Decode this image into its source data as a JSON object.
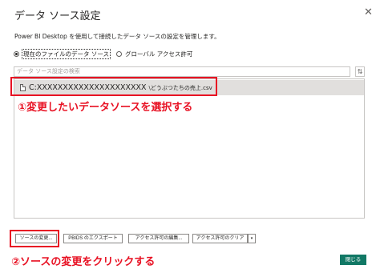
{
  "dialog": {
    "title": "データ ソース設定",
    "close_glyph": "✕",
    "description": "Power BI Desktop を使用して接続したデータ ソースの設定を管理します。"
  },
  "scope": {
    "current_label": "現在のファイルのデータ ソース",
    "global_label": "グローバル アクセス許可",
    "selected": "current"
  },
  "search": {
    "placeholder": "データ ソース設定の検索",
    "scroll_glyph": "⇅"
  },
  "list": {
    "items": [
      {
        "path": "C:XXXXXXXXXXXXXXXXXXXXX",
        "file": "\\どうぶつたちの売上.csv"
      }
    ]
  },
  "annotations": {
    "step1": "①変更したいデータソースを選択する",
    "step2": "②ソースの変更をクリックする",
    "color": "#e81123"
  },
  "buttons": {
    "change_source": "ソースの変更...",
    "export_pbids": "PBIDS のエクスポート",
    "edit_permissions": "アクセス許可の編集...",
    "clear_permissions": "アクセス許可のクリア",
    "clear_dropdown": "▾",
    "close": "閉じる"
  },
  "colors": {
    "accent": "#117865",
    "selection": "#e1dfdd"
  }
}
